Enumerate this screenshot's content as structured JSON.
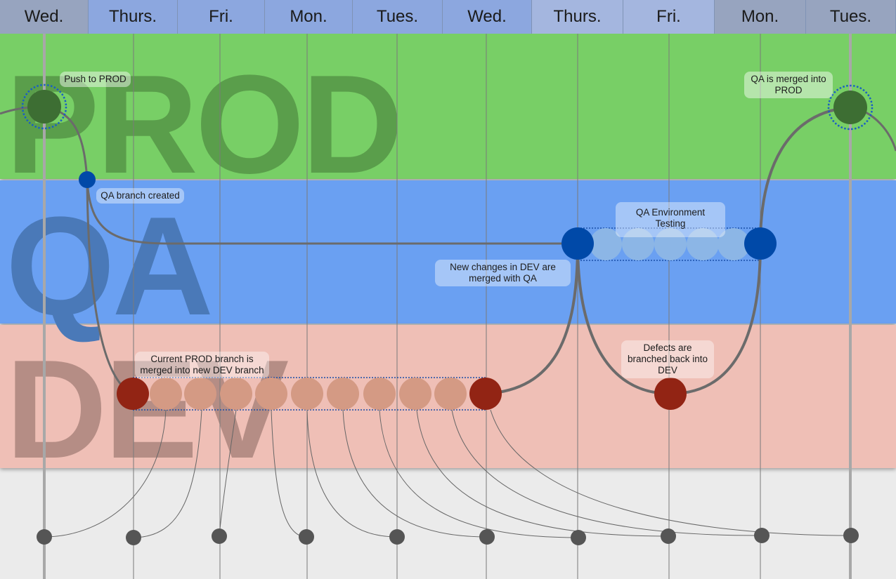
{
  "timeline": {
    "days": [
      {
        "label": "Wed.",
        "color": "#97a4bf"
      },
      {
        "label": "Thurs.",
        "color": "#8ca7df"
      },
      {
        "label": "Fri.",
        "color": "#8ca7df"
      },
      {
        "label": "Mon.",
        "color": "#8ca7df"
      },
      {
        "label": "Tues.",
        "color": "#8ca7df"
      },
      {
        "label": "Wed.",
        "color": "#8ca7df"
      },
      {
        "label": "Thurs.",
        "color": "#a4b6df"
      },
      {
        "label": "Fri.",
        "color": "#a4b6df"
      },
      {
        "label": "Mon.",
        "color": "#97a4bf"
      },
      {
        "label": "Tues.",
        "color": "#97a4bf"
      }
    ]
  },
  "bands": {
    "prod": {
      "label": "PROD",
      "color": "#78cf66",
      "watermark_color": "#5a9e4b"
    },
    "qa": {
      "label": "QA",
      "color": "#6aa0f2",
      "watermark_color": "#4a79b8"
    },
    "dev": {
      "label": "DEV",
      "color": "#efbfb6",
      "watermark_color": "#b58d85"
    }
  },
  "colors": {
    "prod_node": "#3d6e33",
    "qa_node": "#0049a8",
    "qa_commit": "#8cb6e6",
    "dev_node": "#922414",
    "dev_commit": "#d49a84",
    "commit_node": "#555555",
    "branch_line": "#6b6b6b",
    "dotted_ring": "#1a5fc2"
  },
  "annotations": {
    "push_to_prod": "Push to PROD",
    "qa_branch_created": "QA branch created",
    "qa_env_testing": "QA Environment Testing",
    "dev_merged_with_qa": "New changes in DEV are merged with QA",
    "prod_into_dev": "Current PROD branch is merged into new DEV branch",
    "defects_back_to_dev": "Defects are branched back into DEV",
    "qa_into_prod": "QA is merged into PROD"
  }
}
